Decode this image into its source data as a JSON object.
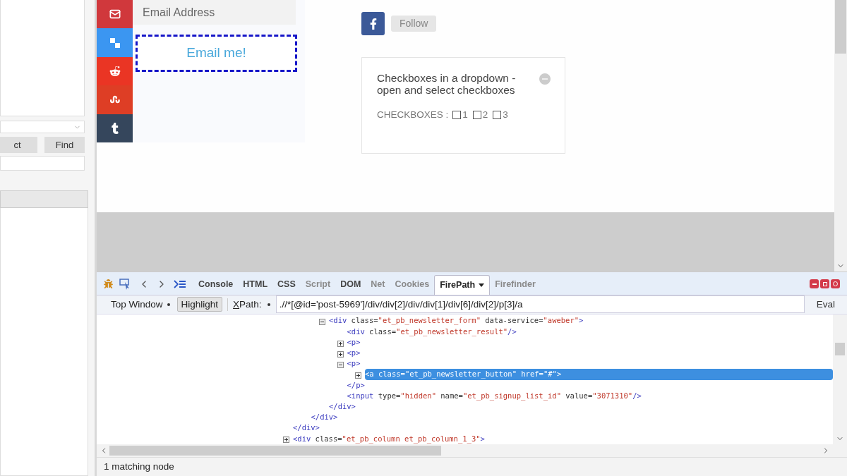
{
  "left_panel": {
    "buttons": [
      "ct",
      "Find"
    ]
  },
  "web_page": {
    "email_field": {
      "placeholder": "Email Address"
    },
    "email_button": {
      "label": "Email me!",
      "highlighted": true
    },
    "follow_button": "Follow",
    "card": {
      "title": "Checkboxes in a dropdown - open and select checkboxes",
      "checkbox_label": "CHECKBOXES :",
      "checkboxes": [
        {
          "label": "1",
          "checked": false
        },
        {
          "label": "2",
          "checked": false
        },
        {
          "label": "3",
          "checked": false
        }
      ]
    }
  },
  "devtools": {
    "tabs": [
      {
        "label": "Console",
        "selected": false,
        "disabled": false
      },
      {
        "label": "HTML",
        "selected": false,
        "disabled": false
      },
      {
        "label": "CSS",
        "selected": false,
        "disabled": false
      },
      {
        "label": "Script",
        "selected": false,
        "disabled": true
      },
      {
        "label": "DOM",
        "selected": false,
        "disabled": false
      },
      {
        "label": "Net",
        "selected": false,
        "disabled": true
      },
      {
        "label": "Cookies",
        "selected": false,
        "disabled": true
      },
      {
        "label": "FirePath",
        "selected": true,
        "disabled": false
      },
      {
        "label": "Firefinder",
        "selected": false,
        "disabled": true
      }
    ],
    "frame_select": "Top Window",
    "highlight_button": {
      "label": "Highlight",
      "on": true
    },
    "xpath_label": "XPath:",
    "xpath_value": ".//*[@id='post-5969']/div/div[2]/div/div[1]/div[6]/div[2]/p[3]/a",
    "eval_button": "Eval",
    "tree": [
      {
        "kind": "ancestor",
        "close": "</div>",
        "children": [
          {
            "kind": "ancestor",
            "close": "</div>",
            "children": [
              {
                "kind": "element",
                "expanded": true,
                "selected": false,
                "open": "<div class=\"et_pb_newsletter_form\" data-service=\"aweber\">",
                "close": "</div>",
                "children": [
                  {
                    "kind": "leaf",
                    "selected": false,
                    "open": "<div class=\"et_pb_newsletter_result\"/>"
                  },
                  {
                    "kind": "element",
                    "expanded": false,
                    "selected": false,
                    "open": "<p>"
                  },
                  {
                    "kind": "element",
                    "expanded": false,
                    "selected": false,
                    "open": "<p>"
                  },
                  {
                    "kind": "element",
                    "expanded": true,
                    "selected": false,
                    "open": "<p>",
                    "close": "</p>",
                    "children": [
                      {
                        "kind": "element",
                        "expanded": false,
                        "selected": true,
                        "open": "<a class=\"et_pb_newsletter_button\" href=\"#\">"
                      }
                    ]
                  },
                  {
                    "kind": "leaf",
                    "selected": false,
                    "open": "<input type=\"hidden\" name=\"et_pb_signup_list_id\" value=\"3071310\"/>"
                  }
                ]
              }
            ]
          }
        ]
      },
      {
        "kind": "element",
        "expanded": false,
        "selected": false,
        "open": "<div class=\"et_pb_column et_pb_column_1_3\">"
      }
    ],
    "status": "1 matching node"
  }
}
